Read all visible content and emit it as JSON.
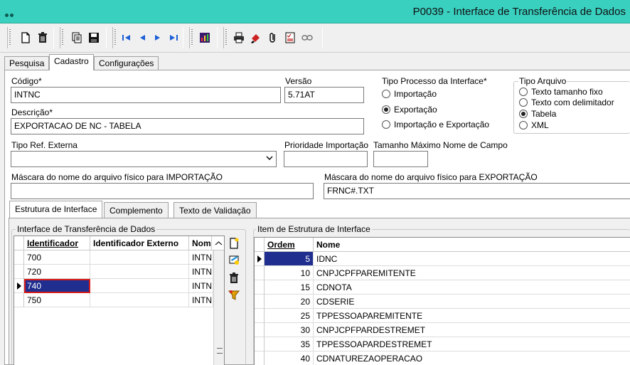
{
  "window": {
    "title": "P0039 - Interface de Transferência de Dados"
  },
  "toolbar": {
    "icons": [
      "new-document-icon",
      "delete-trash-icon",
      "copy-document-icon",
      "save-disk-icon",
      "first-record-icon",
      "previous-record-icon",
      "next-record-icon",
      "last-record-icon",
      "report-icon",
      "print-icon",
      "edit-brush-icon",
      "attach-clip-icon",
      "checklist-icon",
      "link-chain-icon"
    ]
  },
  "tabs": [
    {
      "label": "Pesquisa"
    },
    {
      "label": "Cadastro"
    },
    {
      "label": "Configurações"
    }
  ],
  "form": {
    "codigo_label": "Código*",
    "codigo_value": "INTNC",
    "versao_label": "Versão",
    "versao_value": "5.71AT",
    "descricao_label": "Descrição*",
    "descricao_value": "EXPORTACAO DE NC - TABELA",
    "tipo_processo_label": "Tipo Processo da Interface*",
    "tipo_processo_options": [
      "Importação",
      "Exportação",
      "Importação e Exportação"
    ],
    "tipo_processo_selected": "Exportação",
    "tipo_arquivo_label": "Tipo Arquivo",
    "tipo_arquivo_options": [
      "Texto tamanho fixo",
      "Texto com delimitador",
      "Tabela",
      "XML"
    ],
    "tipo_arquivo_selected": "Tabela",
    "tipo_ref_label": "Tipo Ref. Externa",
    "tipo_ref_value": "",
    "prioridade_label": "Prioridade Importação",
    "prioridade_value": "",
    "tamanho_label": "Tamanho Máximo Nome de Campo",
    "tamanho_value": "",
    "mascara_import_label": "Máscara do nome do arquivo físico para IMPORTAÇÃO",
    "mascara_import_value": "",
    "mascara_export_label": "Máscara do nome do arquivo físico para EXPORTAÇÃO",
    "mascara_export_value": "FRNC#.TXT"
  },
  "subtabs": [
    {
      "label": "Estrutura de Interface"
    },
    {
      "label": "Complemento"
    },
    {
      "label": "Texto de Validação"
    }
  ],
  "left_grid": {
    "title": "Interface de Transferência de Dados",
    "columns": [
      "Identificador",
      "Identificador Externo",
      "Nom"
    ],
    "rows": [
      [
        "700",
        "",
        "INTN"
      ],
      [
        "720",
        "",
        "INTN"
      ],
      [
        "740",
        "",
        "INTN"
      ],
      [
        "750",
        "",
        "INTN"
      ]
    ],
    "selected_row": 2
  },
  "right_grid": {
    "title": "Item de Estrutura de Interface",
    "columns": [
      "Ordem",
      "Nome"
    ],
    "rows": [
      [
        "5",
        "IDNC"
      ],
      [
        "10",
        "CNPJCPFPAREMITENTE"
      ],
      [
        "15",
        "CDNOTA"
      ],
      [
        "20",
        "CDSERIE"
      ],
      [
        "25",
        "TPPESSOAPAREMITENTE"
      ],
      [
        "30",
        "CNPJCPFPARDESTREMET"
      ],
      [
        "35",
        "TPPESSOAPARDESTREMET"
      ],
      [
        "40",
        "CDNATUREZAOPERACAO"
      ]
    ],
    "selected_row": 0
  },
  "colors": {
    "title_bar": "#39d0c0",
    "selection": "#1f2e8f",
    "focus": "#d81b1b"
  }
}
